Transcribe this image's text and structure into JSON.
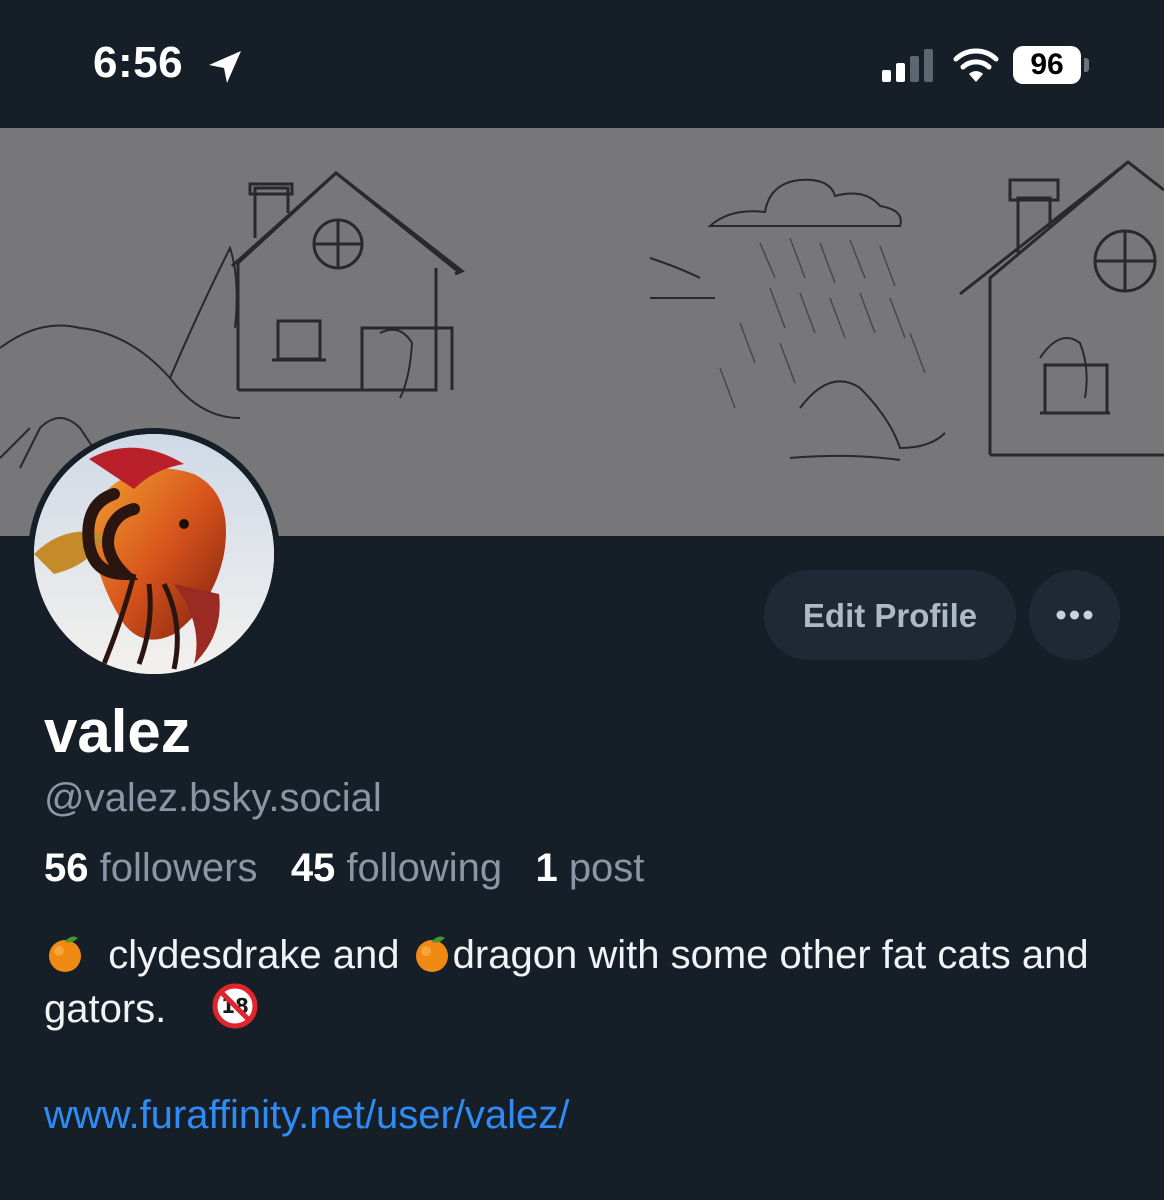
{
  "status_bar": {
    "time": "6:56",
    "battery": "96",
    "icons": [
      "location-arrow-icon",
      "signal-icon",
      "wifi-icon",
      "battery-icon"
    ]
  },
  "profile": {
    "display_name": "valez",
    "handle": "@valez.bsky.social",
    "followers_count": "56",
    "followers_label": "followers",
    "following_count": "45",
    "following_label": "following",
    "posts_count": "1",
    "posts_label": "post",
    "bio_part1": "clydesdrake and",
    "bio_part2": "dragon with some other fat cats and gators.",
    "bio_icons": [
      "orange-emoji-icon",
      "no-under-18-emoji-icon"
    ],
    "link": "www.furaffinity.net/user/valez/"
  },
  "actions": {
    "edit_profile_label": "Edit Profile",
    "more_icon": "more-dots-icon"
  },
  "colors": {
    "background": "#161e27",
    "button": "#1e2935",
    "muted_text": "#8a96a4",
    "link": "#2f8cf5"
  }
}
